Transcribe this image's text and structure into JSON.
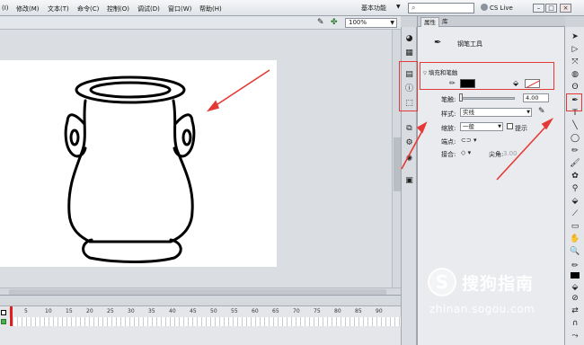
{
  "menubar": {
    "items": [
      "(I)",
      "修改(M)",
      "文本(T)",
      "命令(C)",
      "控制(O)",
      "调试(D)",
      "窗口(W)",
      "帮助(H)"
    ],
    "workspace": "基本功能",
    "search_placeholder": "",
    "cs_live": "CS Live",
    "window_buttons": [
      "–",
      "□",
      "×"
    ]
  },
  "toolbar": {
    "zoom": "100%"
  },
  "timeline": {
    "ruler": [
      "1",
      "5",
      "10",
      "15",
      "20",
      "25",
      "30",
      "35",
      "40",
      "45",
      "50",
      "55",
      "60",
      "65",
      "70",
      "75",
      "80",
      "85",
      "90"
    ]
  },
  "properties": {
    "tabs": [
      "属性",
      "库"
    ],
    "tool_name": "钢笔工具",
    "section_fill_stroke": "填充和笔触",
    "stroke_color": "#000000",
    "fill_color": "none",
    "stroke_label": "笔触:",
    "stroke_value": "4.00",
    "style_label": "样式:",
    "style_value": "实线",
    "scale_label": "缩放:",
    "scale_value": "一般",
    "hint_label": "提示",
    "cap_label": "端点:",
    "join_label": "接合:",
    "miter_label": "尖角:",
    "miter_value": "3.00"
  },
  "watermark": {
    "brand": "搜狗指南",
    "url": "zhinan.sogou.com"
  },
  "colors": {
    "highlight": "#e53935",
    "panel_bg": "#e9ebee"
  }
}
